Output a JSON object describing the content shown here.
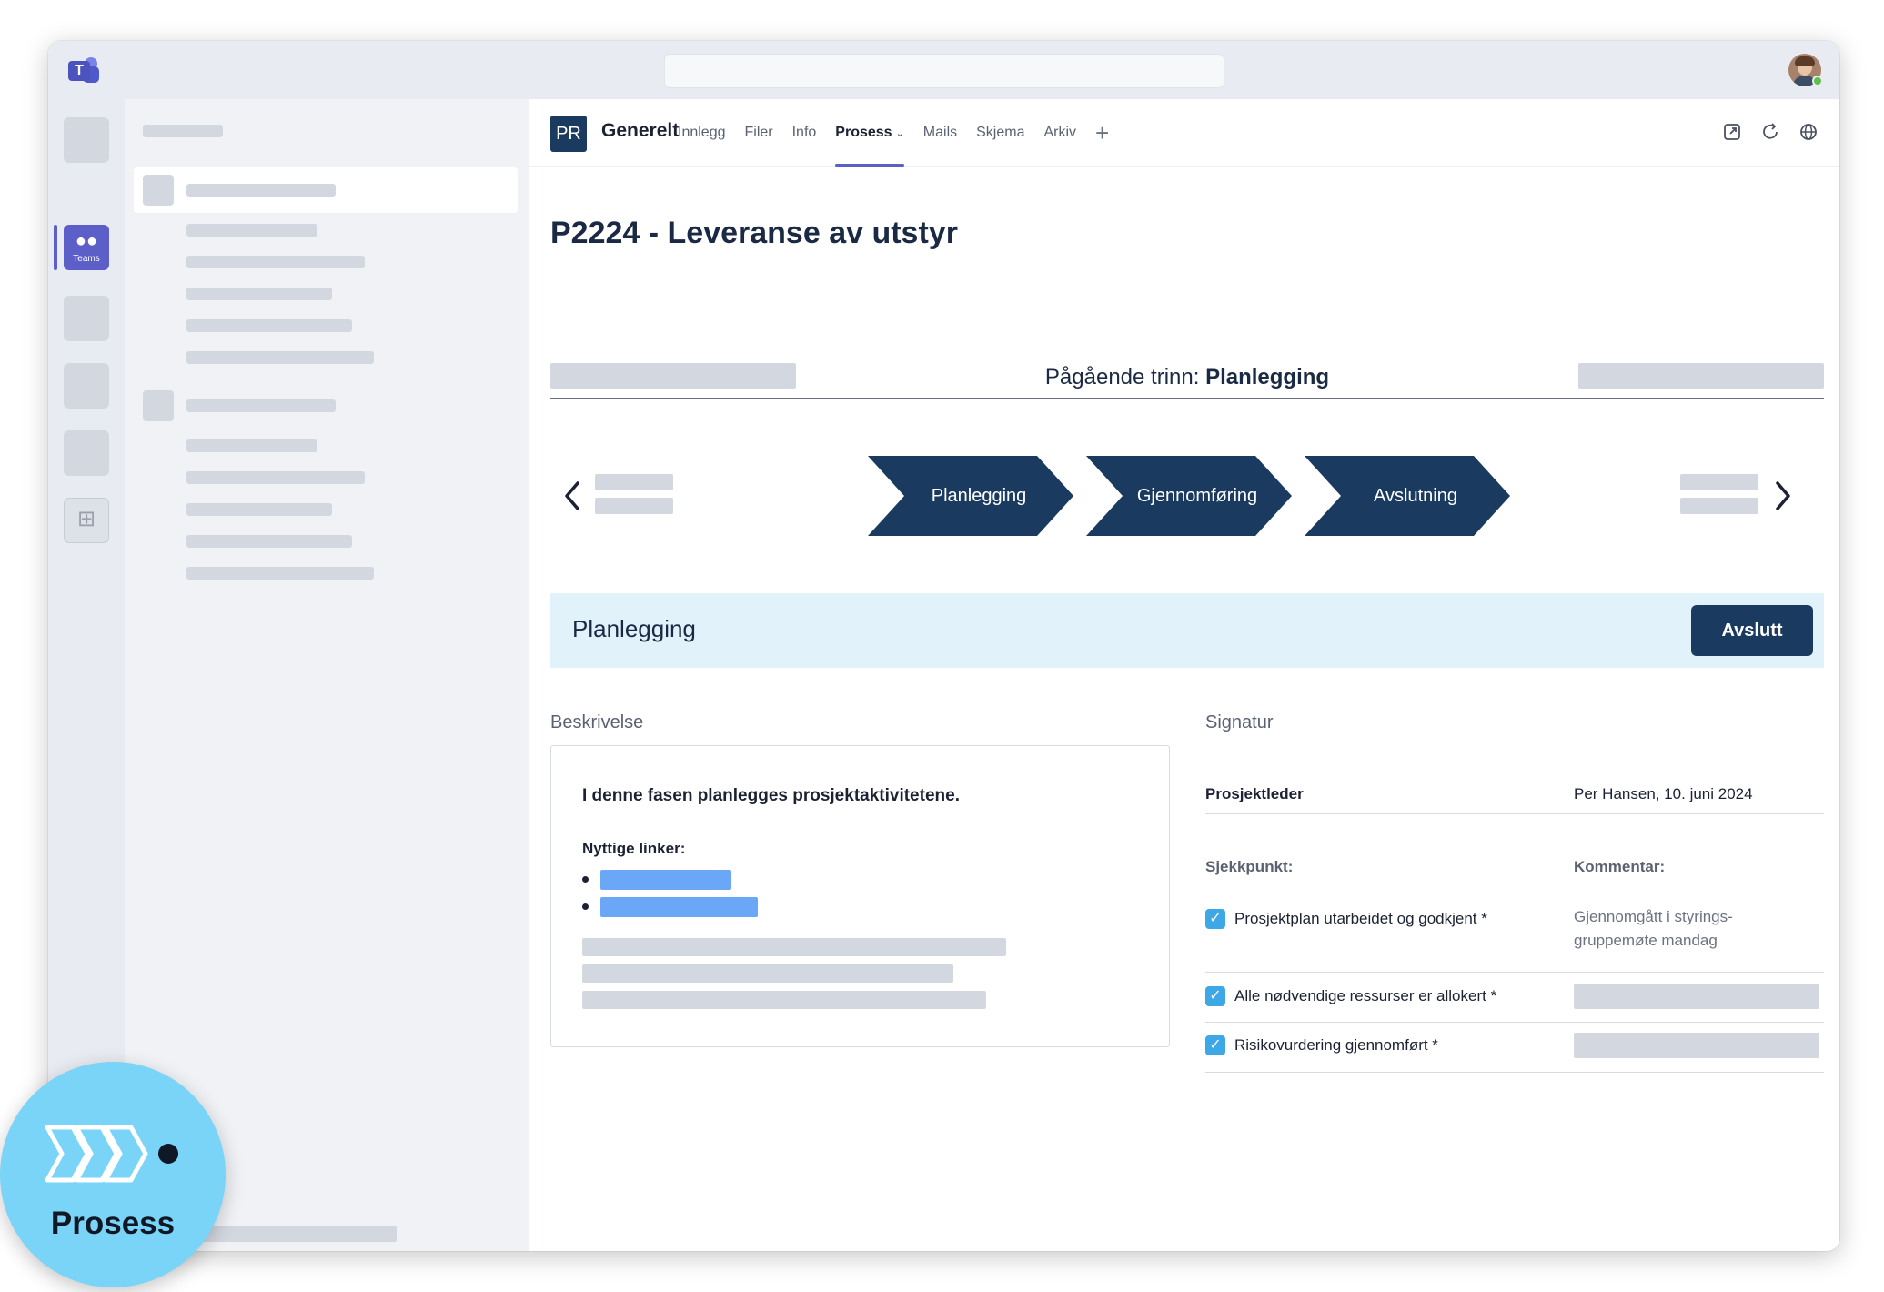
{
  "app": {
    "logo_text": "T",
    "rail": {
      "teams_label": "Teams"
    }
  },
  "channel": {
    "badge": "PR",
    "name": "Generelt",
    "tabs": [
      {
        "label": "Innlegg"
      },
      {
        "label": "Filer"
      },
      {
        "label": "Info"
      },
      {
        "label": "Prosess",
        "active": true
      },
      {
        "label": "Mails"
      },
      {
        "label": "Skjema"
      },
      {
        "label": "Arkiv"
      }
    ],
    "add_tab": "+"
  },
  "page": {
    "title": "P2224 - Leveranse av utstyr",
    "stage_prefix": "Pågående trinn:",
    "stage_current": "Planlegging"
  },
  "flow": {
    "steps": [
      "Planlegging",
      "Gjennomføring",
      "Avslutning"
    ],
    "color": "#1b3a5f"
  },
  "phase": {
    "name": "Planlegging",
    "button": "Avslutt"
  },
  "description": {
    "heading": "Beskrivelse",
    "lead": "I denne fasen planlegges prosjektaktivitetene.",
    "links_heading": "Nyttige linker:"
  },
  "signature": {
    "heading": "Signatur",
    "role": "Prosjektleder",
    "signed_by": "Per Hansen, 10. juni 2024",
    "col_checkpoint": "Sjekkpunkt:",
    "col_comment": "Kommentar:",
    "checkpoints": [
      {
        "label": "Prosjektplan utarbeidet og godkjent *",
        "checked": true,
        "comment": "Gjennomgått i styrings-gruppemøte mandag"
      },
      {
        "label": "Alle nødvendige ressurser er allokert *",
        "checked": true,
        "comment": ""
      },
      {
        "label": "Risikovurdering gjennomført *",
        "checked": true,
        "comment": ""
      }
    ]
  },
  "badge": {
    "label": "Prosess",
    "color": "#79d4f8"
  },
  "icons": {
    "popout": "popout-icon",
    "refresh": "refresh-icon",
    "globe": "globe-icon",
    "back": "chevron-left-icon",
    "forward": "chevron-right-icon"
  }
}
